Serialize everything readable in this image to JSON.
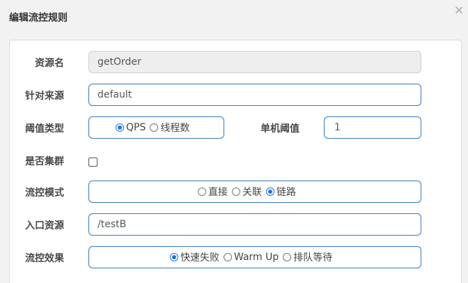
{
  "dialog": {
    "title": "编辑流控规则",
    "close_glyph": "×"
  },
  "form": {
    "resource": {
      "label": "资源名",
      "value": "getOrder"
    },
    "limit_app": {
      "label": "针对来源",
      "value": "default"
    },
    "grade": {
      "label": "阈值类型",
      "options": [
        "QPS",
        "线程数"
      ],
      "selected": "QPS"
    },
    "count": {
      "label": "单机阈值",
      "value": "1"
    },
    "cluster": {
      "label": "是否集群",
      "checked": false
    },
    "strategy": {
      "label": "流控模式",
      "options": [
        "直接",
        "关联",
        "链路"
      ],
      "selected": "链路"
    },
    "ref_resource": {
      "label": "入口资源",
      "value": "/testB"
    },
    "control_behavior": {
      "label": "流控效果",
      "options": [
        "快速失败",
        "Warm Up",
        "排队等待"
      ],
      "selected": "快速失败"
    }
  }
}
